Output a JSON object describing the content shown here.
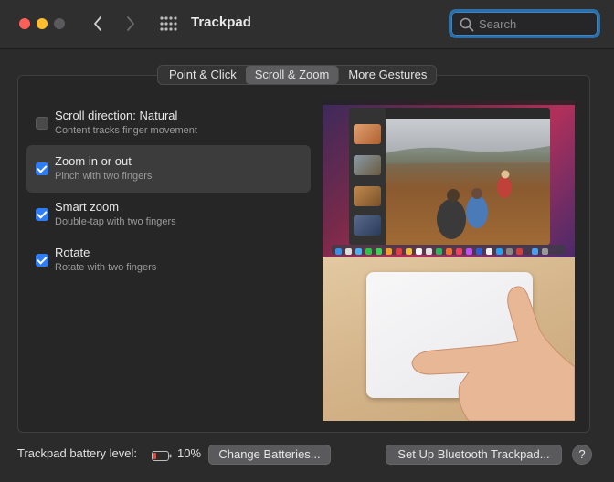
{
  "window": {
    "title": "Trackpad"
  },
  "search": {
    "placeholder": "Search"
  },
  "tabs": [
    {
      "label": "Point & Click",
      "active": false
    },
    {
      "label": "Scroll & Zoom",
      "active": true
    },
    {
      "label": "More Gestures",
      "active": false
    }
  ],
  "options": [
    {
      "title": "Scroll direction: Natural",
      "subtitle": "Content tracks finger movement",
      "checked": false
    },
    {
      "title": "Zoom in or out",
      "subtitle": "Pinch with two fingers",
      "checked": true
    },
    {
      "title": "Smart zoom",
      "subtitle": "Double-tap with two fingers",
      "checked": true
    },
    {
      "title": "Rotate",
      "subtitle": "Rotate with two fingers",
      "checked": true
    }
  ],
  "footer": {
    "battery_label": "Trackpad battery level:",
    "battery_percent": "10%",
    "change_batteries": "Change Batteries...",
    "setup_bluetooth": "Set Up Bluetooth Trackpad...",
    "help": "?"
  },
  "colors": {
    "accent": "#2f7df6",
    "close": "#ff5f57",
    "minimize": "#febc2e",
    "battery_low": "#e5483f"
  }
}
